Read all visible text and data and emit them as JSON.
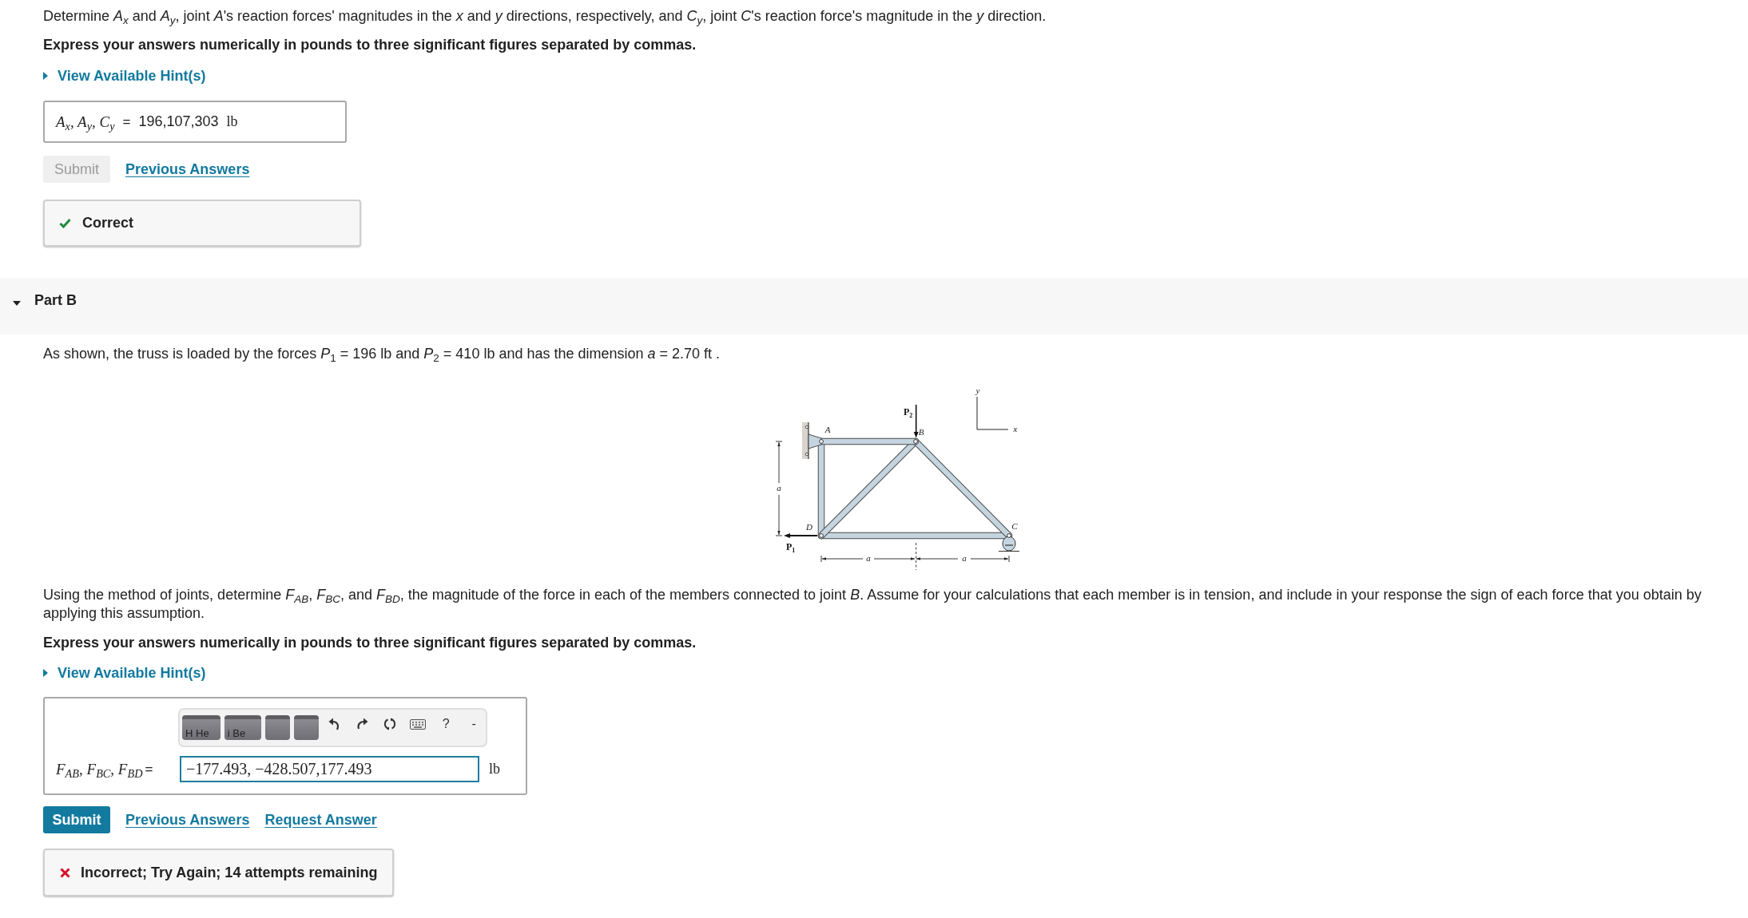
{
  "part_a": {
    "prompt": "Determine *A*$_{x}$ and *A*$_{y}$, joint *A*'s reaction forces' magnitudes in the *x* and *y* directions, respectively, and *C*$_{y}$, joint *C*'s reaction force's magnitude in the *y* direction.",
    "instruction": "Express your answers numerically in pounds to three significant figures separated by commas.",
    "hint": {
      "label": "View Available Hint(s)",
      "expanded": false
    },
    "answer": {
      "label": "A$_{x}$, A$_{y}$, C$_{y}$",
      "equals": "=",
      "value": "196,107,303",
      "unit": "lb"
    },
    "buttons": [
      {
        "kind": "button",
        "label": "Submit",
        "disabled": true
      },
      {
        "kind": "link",
        "label": "Previous Answers",
        "disabled": false
      }
    ],
    "feedback": {
      "kind": "correct",
      "message": "Correct"
    }
  },
  "part_b": {
    "header": {
      "title": "Part B",
      "expanded": true
    },
    "intro": "As shown, the truss is loaded by the forces *P*$_{1}$ = 196 lb and *P*$_{2}$ = 410 lb and has the dimension *a* = 2.70 ft .",
    "figure": {
      "joint_labels": [
        "A",
        "B",
        "C",
        "D"
      ],
      "loads": [
        {
          "symbol": "P",
          "subscript": "2"
        },
        {
          "symbol": "P",
          "subscript": "1"
        }
      ],
      "dimension_labels": [
        "a",
        "a",
        "a"
      ],
      "axis_labels": [
        "y",
        "x"
      ]
    },
    "prompt": "Using the method of joints, determine *F*$_{AB}$, *F*$_{BC}$, and *F*$_{BD}$, the magnitude of the force in each of the members connected to joint *B*. Assume for your calculations that each member is in tension, and include in your response the sign of each force that you obtain by applying this assumption.",
    "instruction": "Express your answers numerically in pounds to three significant figures separated by commas.",
    "hint": {
      "label": "View Available Hint(s)",
      "expanded": false
    },
    "answer": {
      "toolbar": [
        {
          "kind": "tile",
          "label": "H He"
        },
        {
          "kind": "tile",
          "label": "i Be"
        },
        {
          "kind": "tile"
        },
        {
          "kind": "tile"
        },
        {
          "kind": "undo"
        },
        {
          "kind": "redo"
        },
        {
          "kind": "reset"
        },
        {
          "kind": "keyboard"
        },
        {
          "kind": "text",
          "label": "?"
        },
        {
          "kind": "text",
          "label": "-"
        }
      ],
      "label": "F$_{AB}$, F$_{BC}$, F$_{BD}$",
      "equals": "=",
      "value": "−177.493, −428.507,177.493",
      "unit": "lb"
    },
    "buttons": [
      {
        "kind": "button",
        "label": "Submit",
        "disabled": false
      },
      {
        "kind": "link",
        "label": "Previous Answers",
        "disabled": false
      },
      {
        "kind": "link",
        "label": "Request Answer",
        "disabled": false
      }
    ],
    "feedback": {
      "kind": "incorrect",
      "message": "Incorrect; Try Again; 14 attempts remaining"
    }
  }
}
